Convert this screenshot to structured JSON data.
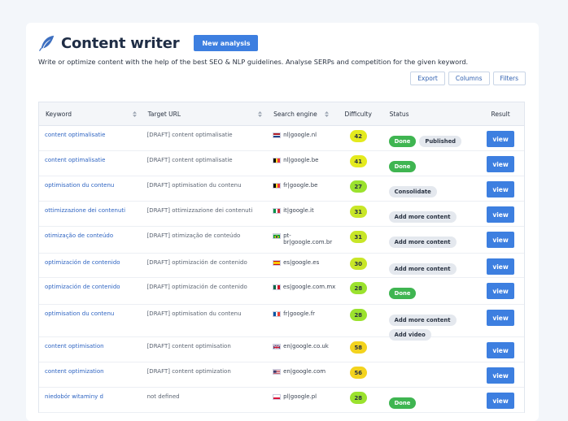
{
  "header": {
    "title": "Content writer",
    "new_analysis_label": "New analysis"
  },
  "subtitle": "Write or optimize content with the help of the best SEO & NLP guidelines. Analyse SERPs and competition for the given keyword.",
  "toolbar": {
    "export_label": "Export",
    "columns_label": "Columns",
    "filters_label": "Filters"
  },
  "table": {
    "columns": [
      "Keyword",
      "Target URL",
      "Search engine",
      "Difficulty",
      "Status",
      "Result"
    ],
    "view_label": "view",
    "rows": [
      {
        "keyword": "content optimalisatie",
        "url": "[DRAFT] content optimalisatie",
        "flag": "nl",
        "engine": "nl|google.nl",
        "difficulty": "42",
        "diff_color": "#e4ea1e",
        "status": [
          {
            "label": "Done",
            "type": "done"
          },
          {
            "label": "Published",
            "type": "gray"
          }
        ],
        "height": 31
      },
      {
        "keyword": "content optimalisatie",
        "url": "[DRAFT] content optimalisatie",
        "flag": "be",
        "engine": "nl|google.be",
        "difficulty": "41",
        "diff_color": "#e4ea1e",
        "status": [
          {
            "label": "Done",
            "type": "done"
          }
        ],
        "height": 31
      },
      {
        "keyword": "optimisation du contenu",
        "url": "[DRAFT] optimisation du contenu",
        "flag": "be",
        "engine": "fr|google.be",
        "difficulty": "27",
        "diff_color": "#9be22e",
        "status": [
          {
            "label": "Consolidate",
            "type": "gray"
          }
        ],
        "height": 31
      },
      {
        "keyword": "ottimizzazione dei contenuti",
        "url": "[DRAFT] ottimizzazione dei contenuti",
        "flag": "it",
        "engine": "it|google.it",
        "difficulty": "31",
        "diff_color": "#c8e628",
        "status": [
          {
            "label": "Add more content",
            "type": "gray"
          }
        ],
        "height": 31
      },
      {
        "keyword": "otimização de conteúdo",
        "url": "[DRAFT] otimização de conteúdo",
        "flag": "br",
        "engine": "pt-br|google.com.br",
        "difficulty": "31",
        "diff_color": "#c8e628",
        "status": [
          {
            "label": "Add more content",
            "type": "gray"
          }
        ],
        "height": 33
      },
      {
        "keyword": "optimización de contenido",
        "url": "[DRAFT] optimización de contenido",
        "flag": "es",
        "engine": "es|google.es",
        "difficulty": "30",
        "diff_color": "#c8e628",
        "status": [
          {
            "label": "Add more content",
            "type": "gray"
          }
        ],
        "height": 30
      },
      {
        "keyword": "optimización de contenido",
        "url": "[DRAFT] optimización de contenido",
        "flag": "mx",
        "engine": "es|google.com.mx",
        "difficulty": "28",
        "diff_color": "#9be22e",
        "status": [
          {
            "label": "Done",
            "type": "done"
          }
        ],
        "height": 33
      },
      {
        "keyword": "optimisation du contenu",
        "url": "[DRAFT] optimisation du contenu",
        "flag": "fr",
        "engine": "fr|google.fr",
        "difficulty": "28",
        "diff_color": "#9be22e",
        "status": [
          {
            "label": "Add more content",
            "type": "gray"
          },
          {
            "label": "Add video",
            "type": "gray"
          }
        ],
        "height": 40
      },
      {
        "keyword": "content optimisation",
        "url": "[DRAFT] content optimisation",
        "flag": "uk",
        "engine": "en|google.co.uk",
        "difficulty": "58",
        "diff_color": "#f3d31e",
        "status": [],
        "height": 31
      },
      {
        "keyword": "content optimization",
        "url": "[DRAFT] content optimization",
        "flag": "us",
        "engine": "en|google.com",
        "difficulty": "56",
        "diff_color": "#f3d31e",
        "status": [],
        "height": 31
      },
      {
        "keyword": "niedobór witaminy d",
        "url": "not defined",
        "flag": "pl",
        "engine": "pl|google.pl",
        "difficulty": "28",
        "diff_color": "#9be22e",
        "status": [
          {
            "label": "Done",
            "type": "done"
          }
        ],
        "height": 31
      }
    ]
  }
}
